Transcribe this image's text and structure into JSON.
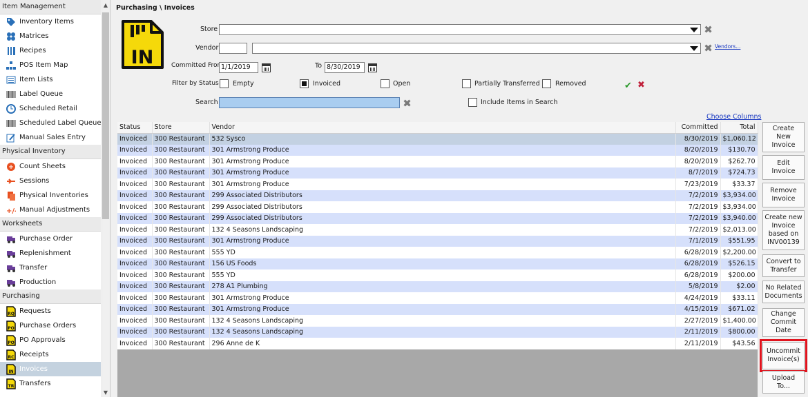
{
  "sidebar": {
    "sections": [
      {
        "title": "Item Management",
        "items": [
          {
            "label": "Inventory Items",
            "icon": "tag-icon"
          },
          {
            "label": "Matrices",
            "icon": "matrix-icon"
          },
          {
            "label": "Recipes",
            "icon": "fork-knife-icon"
          },
          {
            "label": "POS Item Map",
            "icon": "hierarchy-icon"
          },
          {
            "label": "Item Lists",
            "icon": "list-icon"
          },
          {
            "label": "Label Queue",
            "icon": "barcode-icon"
          },
          {
            "label": "Scheduled Retail",
            "icon": "clock-icon"
          },
          {
            "label": "Scheduled Label Queue",
            "icon": "barcode-icon"
          },
          {
            "label": "Manual Sales Entry",
            "icon": "edit-icon"
          }
        ]
      },
      {
        "title": "Physical Inventory",
        "items": [
          {
            "label": "Count Sheets",
            "icon": "count-sheet-icon"
          },
          {
            "label": "Sessions",
            "icon": "sessions-icon"
          },
          {
            "label": "Physical Inventories",
            "icon": "documents-icon"
          },
          {
            "label": "Manual Adjustments",
            "icon": "plus-minus-icon"
          }
        ]
      },
      {
        "title": "Worksheets",
        "items": [
          {
            "label": "Purchase Order",
            "icon": "truck-icon"
          },
          {
            "label": "Replenishment",
            "icon": "truck-icon"
          },
          {
            "label": "Transfer",
            "icon": "truck-icon"
          },
          {
            "label": "Production",
            "icon": "truck-icon"
          }
        ]
      },
      {
        "title": "Purchasing",
        "items": [
          {
            "label": "Requests",
            "icon": "rq-doc-icon",
            "badge": "RQ"
          },
          {
            "label": "Purchase Orders",
            "icon": "po-doc-icon",
            "badge": "PO"
          },
          {
            "label": "PO Approvals",
            "icon": "po-doc-icon",
            "badge": "PO"
          },
          {
            "label": "Receipts",
            "icon": "rc-doc-icon",
            "badge": "RC"
          },
          {
            "label": "Invoices",
            "icon": "in-doc-icon",
            "badge": "IN",
            "selected": true
          },
          {
            "label": "Transfers",
            "icon": "tr-doc-icon",
            "badge": "TR"
          }
        ]
      }
    ]
  },
  "header": {
    "breadcrumb": "Purchasing \\ Invoices",
    "page_icon_text": "IN"
  },
  "filters": {
    "store_label": "Store",
    "store_value": "",
    "vendor_label": "Vendor",
    "vendor_code": "",
    "vendor_value": "",
    "vendors_link": "Vendors...",
    "committed_from_label": "Committed From",
    "committed_from": "1/1/2019",
    "to_label": "To",
    "committed_to": "8/30/2019",
    "filter_status_label": "Filter by Status",
    "statuses": [
      {
        "label": "Empty",
        "checked": false
      },
      {
        "label": "Invoiced",
        "checked": true
      },
      {
        "label": "Open",
        "checked": false
      },
      {
        "label": "Partially Transferred",
        "checked": false
      },
      {
        "label": "Removed",
        "checked": false
      }
    ],
    "search_label": "Search",
    "search_value": "",
    "include_items_label": "Include Items in Search",
    "include_items_checked": false
  },
  "choose_columns": "Choose Columns",
  "table": {
    "columns": [
      "Status",
      "Store",
      "Vendor",
      "Committed",
      "Total"
    ],
    "rows": [
      [
        "Invoiced",
        "300 Restaurant",
        "532 Sysco",
        "8/30/2019",
        "$1,060.12"
      ],
      [
        "Invoiced",
        "300 Restaurant",
        "301 Armstrong Produce",
        "8/20/2019",
        "$130.70"
      ],
      [
        "Invoiced",
        "300 Restaurant",
        "301 Armstrong Produce",
        "8/20/2019",
        "$262.70"
      ],
      [
        "Invoiced",
        "300 Restaurant",
        "301 Armstrong Produce",
        "8/7/2019",
        "$724.73"
      ],
      [
        "Invoiced",
        "300 Restaurant",
        "301 Armstrong Produce",
        "7/23/2019",
        "$33.37"
      ],
      [
        "Invoiced",
        "300 Restaurant",
        "299 Associated Distributors",
        "7/2/2019",
        "$3,934.00"
      ],
      [
        "Invoiced",
        "300 Restaurant",
        "299 Associated Distributors",
        "7/2/2019",
        "$3,934.00"
      ],
      [
        "Invoiced",
        "300 Restaurant",
        "299 Associated Distributors",
        "7/2/2019",
        "$3,940.00"
      ],
      [
        "Invoiced",
        "300 Restaurant",
        "132 4 Seasons Landscaping",
        "7/2/2019",
        "$2,013.00"
      ],
      [
        "Invoiced",
        "300 Restaurant",
        "301 Armstrong Produce",
        "7/1/2019",
        "$551.95"
      ],
      [
        "Invoiced",
        "300 Restaurant",
        "555 YD",
        "6/28/2019",
        "$2,200.00"
      ],
      [
        "Invoiced",
        "300 Restaurant",
        "156 US Foods",
        "6/28/2019",
        "$526.15"
      ],
      [
        "Invoiced",
        "300 Restaurant",
        "555 YD",
        "6/28/2019",
        "$200.00"
      ],
      [
        "Invoiced",
        "300 Restaurant",
        "278 A1 Plumbing",
        "5/8/2019",
        "$2.00"
      ],
      [
        "Invoiced",
        "300 Restaurant",
        "301 Armstrong Produce",
        "4/24/2019",
        "$33.11"
      ],
      [
        "Invoiced",
        "300 Restaurant",
        "301 Armstrong Produce",
        "4/15/2019",
        "$671.02"
      ],
      [
        "Invoiced",
        "300 Restaurant",
        "132 4 Seasons Landscaping",
        "2/27/2019",
        "$1,400.00"
      ],
      [
        "Invoiced",
        "300 Restaurant",
        "132 4 Seasons Landscaping",
        "2/11/2019",
        "$800.00"
      ],
      [
        "Invoiced",
        "300 Restaurant",
        "296 Anne de K",
        "2/11/2019",
        "$43.56"
      ]
    ]
  },
  "actions": [
    {
      "label": "Create New Invoice",
      "lines": [
        "Create",
        "New",
        "Invoice"
      ]
    },
    {
      "label": "Edit Invoice",
      "lines": [
        "Edit",
        "Invoice"
      ]
    },
    {
      "label": "Remove Invoice",
      "lines": [
        "Remove",
        "Invoice"
      ]
    },
    {
      "label": "Create new Invoice based on INV00139",
      "lines": [
        "Create new",
        "Invoice",
        "based on",
        "INV00139"
      ]
    },
    {
      "label": "Convert to Transfer",
      "lines": [
        "Convert to",
        "Transfer"
      ]
    },
    {
      "label": "No Related Documents",
      "lines": [
        "No Related",
        "Documents"
      ]
    },
    {
      "label": "Change Commit Date",
      "lines": [
        "Change",
        "Commit",
        "Date"
      ]
    },
    {
      "label": "Uncommit Invoice(s)",
      "lines": [
        "Uncommit",
        "Invoice(s)"
      ],
      "highlighted": true
    },
    {
      "label": "Upload To...",
      "lines": [
        "Upload",
        "To..."
      ]
    }
  ],
  "colors": {
    "accent_yellow": "#f5d90a",
    "row_alt": "#d6e0fb",
    "row_selected": "#c3d1e2",
    "highlight_border": "#e0141e",
    "apply_green": "#2e9b2e",
    "cancel_red": "#c0203a"
  }
}
